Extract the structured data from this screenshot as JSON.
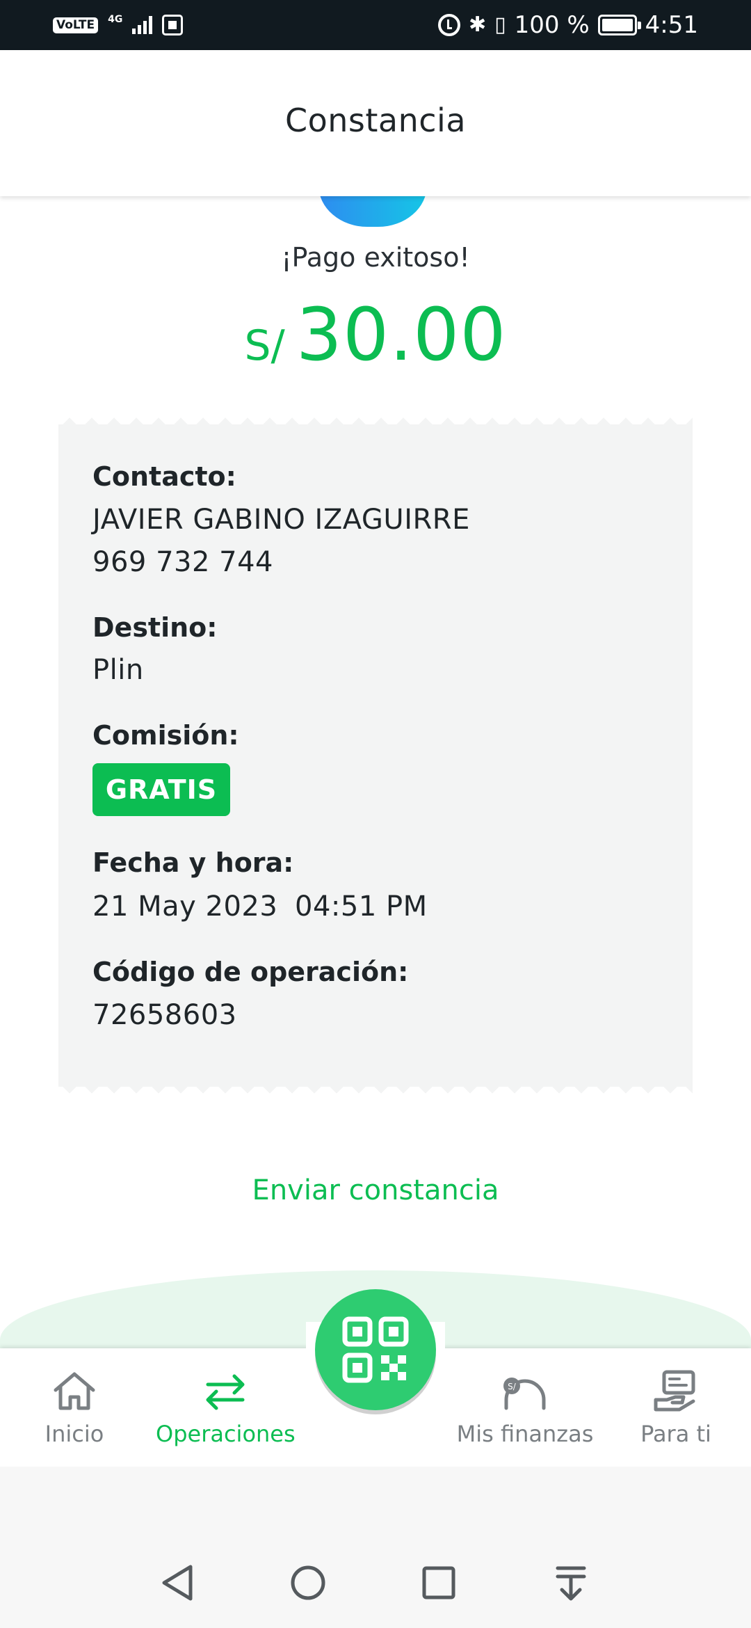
{
  "status_bar": {
    "volte": "VoLTE",
    "network": "4G",
    "battery_percent": "100 %",
    "time": "4:51",
    "icons": [
      "volte-icon",
      "signal-icon",
      "sim-icon",
      "alarm-icon",
      "bluetooth-icon",
      "vibrate-icon",
      "battery-icon"
    ]
  },
  "header": {
    "title": "Constancia"
  },
  "payment": {
    "status": "¡Pago exitoso!",
    "currency": "S/",
    "amount": "30.00"
  },
  "receipt": {
    "contact_label": "Contacto:",
    "contact_name": "JAVIER GABINO IZAGUIRRE",
    "contact_phone": "969 732 744",
    "destination_label": "Destino:",
    "destination_value": "Plin",
    "commission_label": "Comisión:",
    "commission_badge": "GRATIS",
    "datetime_label": "Fecha y hora:",
    "date": "21 May 2023",
    "time": "04:51 PM",
    "operation_label": "Código de operación:",
    "operation_code": "72658603"
  },
  "actions": {
    "send_receipt": "Enviar constancia"
  },
  "bottom_nav": {
    "items": [
      {
        "label": "Inicio",
        "icon": "home-icon"
      },
      {
        "label": "Operaciones",
        "icon": "transfer-arrows-icon"
      },
      {
        "label": "Mis finanzas",
        "icon": "finance-gauge-icon"
      },
      {
        "label": "Para ti",
        "icon": "offer-hand-icon"
      }
    ],
    "active_index": 1,
    "qr_icon": "qr-code-icon"
  },
  "colors": {
    "accent": "#0cbd52",
    "status_bar": "#111a20",
    "receipt_bg": "#f3f4f4",
    "nav_inactive": "#7a7f83"
  }
}
